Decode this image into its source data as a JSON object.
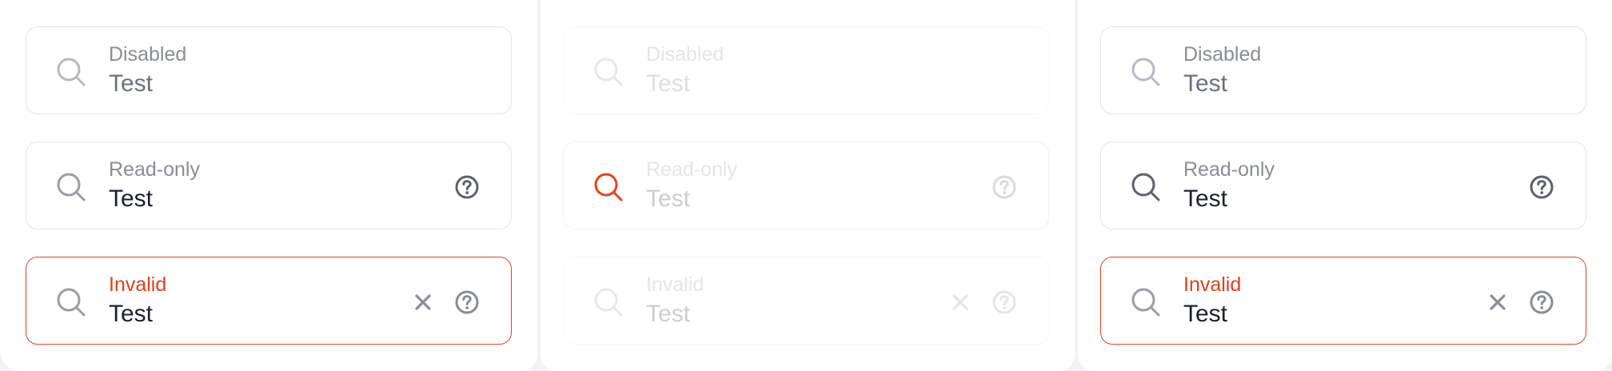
{
  "columns": [
    {
      "disabled": {
        "label": "Disabled",
        "value": "Test"
      },
      "readonly": {
        "label": "Read-only",
        "value": "Test"
      },
      "invalid": {
        "label": "Invalid",
        "value": "Test"
      }
    },
    {
      "disabled": {
        "label": "Disabled",
        "value": "Test"
      },
      "readonly": {
        "label": "Read-only",
        "value": "Test"
      },
      "invalid": {
        "label": "Invalid",
        "value": "Test"
      }
    },
    {
      "disabled": {
        "label": "Disabled",
        "value": "Test"
      },
      "readonly": {
        "label": "Read-only",
        "value": "Test"
      },
      "invalid": {
        "label": "Invalid",
        "value": "Test"
      }
    }
  ],
  "icons": {
    "search": "search-icon",
    "clear": "close-icon",
    "help": "help-icon"
  },
  "colors": {
    "border": "#e3e4ea",
    "invalid": "#e5441c",
    "label": "#8a8d99",
    "text": "#1d2030",
    "icon": "#9a9ca6",
    "icon_dark": "#5e6070",
    "search_highlight": "#e5441c"
  }
}
